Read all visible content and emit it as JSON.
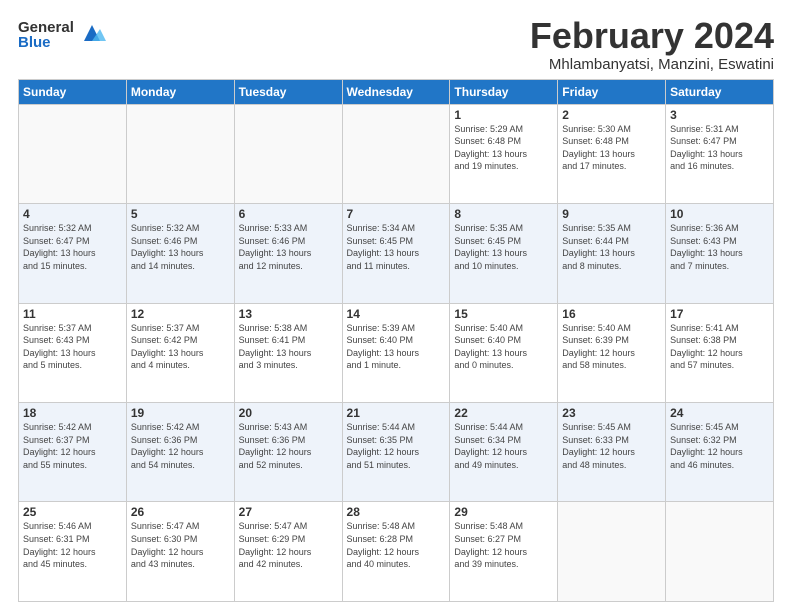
{
  "logo": {
    "general": "General",
    "blue": "Blue"
  },
  "header": {
    "month": "February 2024",
    "location": "Mhlambanyatsi, Manzini, Eswatini"
  },
  "weekdays": [
    "Sunday",
    "Monday",
    "Tuesday",
    "Wednesday",
    "Thursday",
    "Friday",
    "Saturday"
  ],
  "weeks": [
    [
      {
        "day": "",
        "info": ""
      },
      {
        "day": "",
        "info": ""
      },
      {
        "day": "",
        "info": ""
      },
      {
        "day": "",
        "info": ""
      },
      {
        "day": "1",
        "info": "Sunrise: 5:29 AM\nSunset: 6:48 PM\nDaylight: 13 hours\nand 19 minutes."
      },
      {
        "day": "2",
        "info": "Sunrise: 5:30 AM\nSunset: 6:48 PM\nDaylight: 13 hours\nand 17 minutes."
      },
      {
        "day": "3",
        "info": "Sunrise: 5:31 AM\nSunset: 6:47 PM\nDaylight: 13 hours\nand 16 minutes."
      }
    ],
    [
      {
        "day": "4",
        "info": "Sunrise: 5:32 AM\nSunset: 6:47 PM\nDaylight: 13 hours\nand 15 minutes."
      },
      {
        "day": "5",
        "info": "Sunrise: 5:32 AM\nSunset: 6:46 PM\nDaylight: 13 hours\nand 14 minutes."
      },
      {
        "day": "6",
        "info": "Sunrise: 5:33 AM\nSunset: 6:46 PM\nDaylight: 13 hours\nand 12 minutes."
      },
      {
        "day": "7",
        "info": "Sunrise: 5:34 AM\nSunset: 6:45 PM\nDaylight: 13 hours\nand 11 minutes."
      },
      {
        "day": "8",
        "info": "Sunrise: 5:35 AM\nSunset: 6:45 PM\nDaylight: 13 hours\nand 10 minutes."
      },
      {
        "day": "9",
        "info": "Sunrise: 5:35 AM\nSunset: 6:44 PM\nDaylight: 13 hours\nand 8 minutes."
      },
      {
        "day": "10",
        "info": "Sunrise: 5:36 AM\nSunset: 6:43 PM\nDaylight: 13 hours\nand 7 minutes."
      }
    ],
    [
      {
        "day": "11",
        "info": "Sunrise: 5:37 AM\nSunset: 6:43 PM\nDaylight: 13 hours\nand 5 minutes."
      },
      {
        "day": "12",
        "info": "Sunrise: 5:37 AM\nSunset: 6:42 PM\nDaylight: 13 hours\nand 4 minutes."
      },
      {
        "day": "13",
        "info": "Sunrise: 5:38 AM\nSunset: 6:41 PM\nDaylight: 13 hours\nand 3 minutes."
      },
      {
        "day": "14",
        "info": "Sunrise: 5:39 AM\nSunset: 6:40 PM\nDaylight: 13 hours\nand 1 minute."
      },
      {
        "day": "15",
        "info": "Sunrise: 5:40 AM\nSunset: 6:40 PM\nDaylight: 13 hours\nand 0 minutes."
      },
      {
        "day": "16",
        "info": "Sunrise: 5:40 AM\nSunset: 6:39 PM\nDaylight: 12 hours\nand 58 minutes."
      },
      {
        "day": "17",
        "info": "Sunrise: 5:41 AM\nSunset: 6:38 PM\nDaylight: 12 hours\nand 57 minutes."
      }
    ],
    [
      {
        "day": "18",
        "info": "Sunrise: 5:42 AM\nSunset: 6:37 PM\nDaylight: 12 hours\nand 55 minutes."
      },
      {
        "day": "19",
        "info": "Sunrise: 5:42 AM\nSunset: 6:36 PM\nDaylight: 12 hours\nand 54 minutes."
      },
      {
        "day": "20",
        "info": "Sunrise: 5:43 AM\nSunset: 6:36 PM\nDaylight: 12 hours\nand 52 minutes."
      },
      {
        "day": "21",
        "info": "Sunrise: 5:44 AM\nSunset: 6:35 PM\nDaylight: 12 hours\nand 51 minutes."
      },
      {
        "day": "22",
        "info": "Sunrise: 5:44 AM\nSunset: 6:34 PM\nDaylight: 12 hours\nand 49 minutes."
      },
      {
        "day": "23",
        "info": "Sunrise: 5:45 AM\nSunset: 6:33 PM\nDaylight: 12 hours\nand 48 minutes."
      },
      {
        "day": "24",
        "info": "Sunrise: 5:45 AM\nSunset: 6:32 PM\nDaylight: 12 hours\nand 46 minutes."
      }
    ],
    [
      {
        "day": "25",
        "info": "Sunrise: 5:46 AM\nSunset: 6:31 PM\nDaylight: 12 hours\nand 45 minutes."
      },
      {
        "day": "26",
        "info": "Sunrise: 5:47 AM\nSunset: 6:30 PM\nDaylight: 12 hours\nand 43 minutes."
      },
      {
        "day": "27",
        "info": "Sunrise: 5:47 AM\nSunset: 6:29 PM\nDaylight: 12 hours\nand 42 minutes."
      },
      {
        "day": "28",
        "info": "Sunrise: 5:48 AM\nSunset: 6:28 PM\nDaylight: 12 hours\nand 40 minutes."
      },
      {
        "day": "29",
        "info": "Sunrise: 5:48 AM\nSunset: 6:27 PM\nDaylight: 12 hours\nand 39 minutes."
      },
      {
        "day": "",
        "info": ""
      },
      {
        "day": "",
        "info": ""
      }
    ]
  ]
}
